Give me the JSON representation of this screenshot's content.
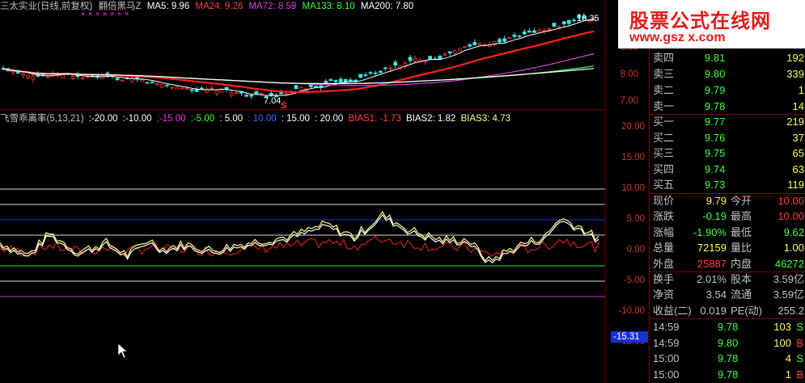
{
  "header": {
    "title": "三太实业(日线,前复权)",
    "indicator": "翻倍黑马Z",
    "ma5": "MA5: 9.96",
    "ma24": "MA24: 9.26",
    "ma72": "MA72: 8.59",
    "ma133": "MA133: 8.10",
    "ma200": "MA200: 7.80",
    "colors": {
      "ma5": "#ffffff",
      "ma24": "#ff4040",
      "ma72": "#e040e0",
      "ma133": "#40ff40",
      "ma200": "#ffffff"
    }
  },
  "kline": {
    "y_labels": [
      "9.00",
      "8.00",
      "7.00"
    ],
    "low_annot": "7.04",
    "high_annot": "10.35",
    "s_mark": "S"
  },
  "indicator_header": {
    "name": "飞雪乖离率(5,13,21)",
    "levels": [
      ":-20.00",
      ":-10.00",
      ":-15.00",
      ":-5.00",
      ": 5.00",
      ": 10.00",
      ": 15.00",
      ": 20.00"
    ],
    "bias1": "BIAS1: -1.73",
    "bias2": "BIAS2: 1.82",
    "bias3": "BIAS3: 4.73"
  },
  "indicator_axis": [
    "20.00",
    "15.00",
    "10.00",
    "5.00",
    "0.00",
    "-5.00",
    "-10.00",
    "-15.00"
  ],
  "marker_value": "-15.31",
  "logo": {
    "title": "股票公式在线网",
    "url": "www.gsz x.com"
  },
  "order_book": {
    "asks": [
      {
        "label": "卖四",
        "price": "9.81",
        "vol": "192"
      },
      {
        "label": "卖三",
        "price": "9.80",
        "vol": "339"
      },
      {
        "label": "卖二",
        "price": "9.79",
        "vol": "1"
      },
      {
        "label": "卖一",
        "price": "9.78",
        "vol": "14"
      }
    ],
    "bids": [
      {
        "label": "买一",
        "price": "9.77",
        "vol": "219"
      },
      {
        "label": "买二",
        "price": "9.76",
        "vol": "37"
      },
      {
        "label": "买三",
        "price": "9.75",
        "vol": "65"
      },
      {
        "label": "买四",
        "price": "9.74",
        "vol": "63"
      },
      {
        "label": "买五",
        "price": "9.73",
        "vol": "119"
      }
    ]
  },
  "quote": [
    {
      "l1": "现价",
      "v1": "9.79",
      "l2": "今开",
      "v2": "10.00",
      "c1": "#ffff40",
      "c2": "#ff4040"
    },
    {
      "l1": "涨跌",
      "v1": "-0.19",
      "l2": "最高",
      "v2": "10.00",
      "c1": "#40ff40",
      "c2": "#ff4040"
    },
    {
      "l1": "涨幅",
      "v1": "-1.90%",
      "l2": "最低",
      "v2": "9.62",
      "c1": "#40ff40",
      "c2": "#40ff40"
    },
    {
      "l1": "总量",
      "v1": "72159",
      "l2": "量比",
      "v2": "1.00",
      "c1": "#ffff40",
      "c2": "#ffff40"
    },
    {
      "l1": "外盘",
      "v1": "25887",
      "l2": "内盘",
      "v2": "46272",
      "c1": "#ff4040",
      "c2": "#40ff40"
    }
  ],
  "info": [
    {
      "l1": "换手",
      "v1": "2.01%",
      "l2": "股本",
      "v2": "3.59亿"
    },
    {
      "l1": "净资",
      "v1": "3.54",
      "l2": "流通",
      "v2": "3.59亿"
    },
    {
      "l1": "收益(二)",
      "v1": "0.019",
      "l2": "PE(动)",
      "v2": "255.2"
    }
  ],
  "ticks": [
    {
      "time": "14:59",
      "price": "9.78",
      "vol": "103",
      "side": "S"
    },
    {
      "time": "14:59",
      "price": "9.80",
      "vol": "100",
      "side": "B"
    },
    {
      "time": "15:00",
      "price": "9.78",
      "vol": "4",
      "side": "S"
    },
    {
      "time": "15:00",
      "price": "9.78",
      "vol": "1",
      "side": "B"
    }
  ]
}
